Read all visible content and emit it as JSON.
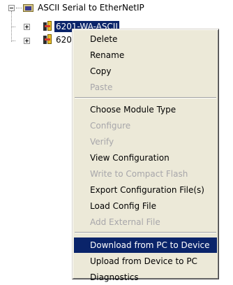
{
  "tree": {
    "root_label": "ASCII Serial to EtherNetIP",
    "children": [
      {
        "label": "6201-WA-ASCII",
        "selected": true
      },
      {
        "label": "620"
      }
    ]
  },
  "menu": {
    "items": [
      {
        "label": "Delete",
        "enabled": true
      },
      {
        "label": "Rename",
        "enabled": true
      },
      {
        "label": "Copy",
        "enabled": true
      },
      {
        "label": "Paste",
        "enabled": false
      },
      {
        "label": "Choose Module Type",
        "enabled": true
      },
      {
        "label": "Configure",
        "enabled": false
      },
      {
        "label": "Verify",
        "enabled": false
      },
      {
        "label": "View Configuration",
        "enabled": true
      },
      {
        "label": "Write to Compact Flash",
        "enabled": false
      },
      {
        "label": "Export Configuration File(s)",
        "enabled": true
      },
      {
        "label": "Load Config File",
        "enabled": true
      },
      {
        "label": "Add External File",
        "enabled": false
      },
      {
        "label": "Download from PC to Device",
        "enabled": true,
        "highlighted": true
      },
      {
        "label": "Upload from Device to PC",
        "enabled": true
      },
      {
        "label": "Diagnostics",
        "enabled": true
      }
    ]
  },
  "colors": {
    "highlight": "#0a246a",
    "menu_background": "#ece9d8",
    "disabled_text": "#a7a6aa"
  },
  "icons": [
    "collapse-icon",
    "folder-icon",
    "expand-icon",
    "device-icon"
  ]
}
